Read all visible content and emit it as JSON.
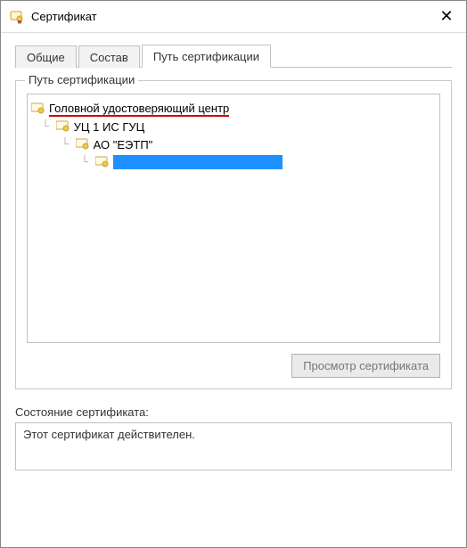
{
  "window": {
    "title": "Сертификат",
    "close_glyph": "✕"
  },
  "tabs": {
    "general": "Общие",
    "details": "Состав",
    "path": "Путь сертификации"
  },
  "group": {
    "path_legend": "Путь сертификации"
  },
  "tree": {
    "root": "Головной удостоверяющий центр",
    "level1": "УЦ 1 ИС ГУЦ",
    "level2": "АО \"ЕЭТП\"",
    "leaf": ""
  },
  "buttons": {
    "view_cert": "Просмотр сертификата"
  },
  "status": {
    "label": "Состояние сертификата:",
    "text": "Этот сертификат действителен."
  }
}
